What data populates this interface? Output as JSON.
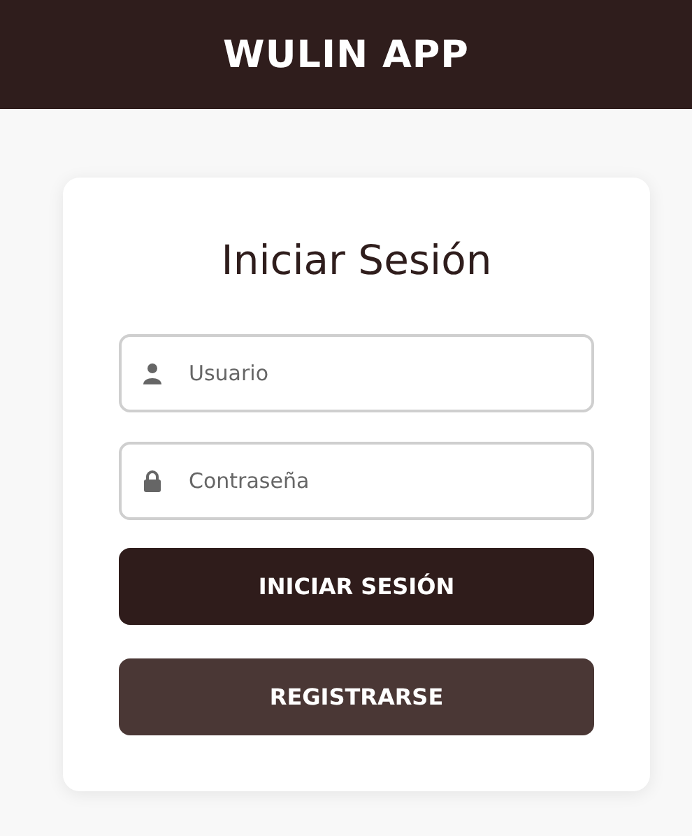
{
  "header": {
    "title": "WULIN APP"
  },
  "login": {
    "heading": "Iniciar Sesión",
    "fields": [
      {
        "kind": "user",
        "placeholder": "Usuario"
      },
      {
        "kind": "lock",
        "placeholder": "Contraseña"
      }
    ],
    "buttons": [
      {
        "kind": "primary",
        "label": "INICIAR SESIÓN"
      },
      {
        "kind": "secondary",
        "label": "REGISTRARSE"
      }
    ]
  }
}
